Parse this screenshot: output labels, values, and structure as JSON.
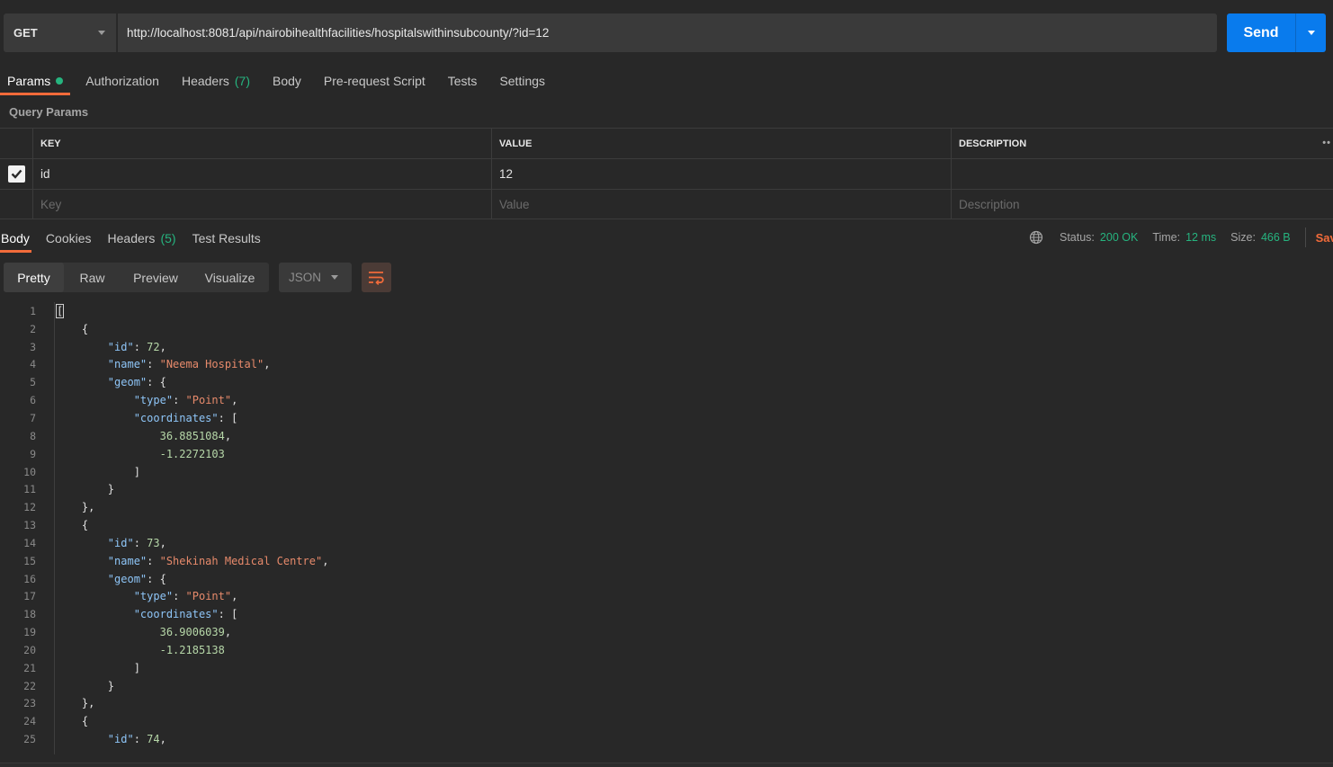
{
  "request": {
    "method": "GET",
    "url": "http://localhost:8081/api/nairobihealthfacilities/hospitalswithinsubcounty/?id=12",
    "send_label": "Send"
  },
  "request_tabs": [
    {
      "label": "Params",
      "active": true
    },
    {
      "label": "Authorization"
    },
    {
      "label": "Headers",
      "count": "(7)"
    },
    {
      "label": "Body"
    },
    {
      "label": "Pre-request Script"
    },
    {
      "label": "Tests"
    },
    {
      "label": "Settings"
    }
  ],
  "query_params": {
    "title": "Query Params",
    "headers": [
      "KEY",
      "VALUE",
      "DESCRIPTION"
    ],
    "rows": [
      {
        "checked": true,
        "key": "id",
        "value": "12",
        "description": ""
      }
    ],
    "placeholders": {
      "key": "Key",
      "value": "Value",
      "description": "Description"
    }
  },
  "response_tabs": [
    {
      "label": "Body",
      "active": true
    },
    {
      "label": "Cookies"
    },
    {
      "label": "Headers",
      "count": "(5)"
    },
    {
      "label": "Test Results"
    }
  ],
  "response_meta": {
    "status_label": "Status:",
    "status_value": "200 OK",
    "time_label": "Time:",
    "time_value": "12 ms",
    "size_label": "Size:",
    "size_value": "466 B",
    "save_label": "Save"
  },
  "view_modes": [
    "Pretty",
    "Raw",
    "Preview",
    "Visualize"
  ],
  "format": "JSON",
  "code_lines": [
    "[",
    "    {",
    "        \"id\": 72,",
    "        \"name\": \"Neema Hospital\",",
    "        \"geom\": {",
    "            \"type\": \"Point\",",
    "            \"coordinates\": [",
    "                36.8851084,",
    "                -1.2272103",
    "            ]",
    "        }",
    "    },",
    "    {",
    "        \"id\": 73,",
    "        \"name\": \"Shekinah Medical Centre\",",
    "        \"geom\": {",
    "            \"type\": \"Point\",",
    "            \"coordinates\": [",
    "                36.9006039,",
    "                -1.2185138",
    "            ]",
    "        }",
    "    },",
    "    {",
    "        \"id\": 74,"
  ]
}
